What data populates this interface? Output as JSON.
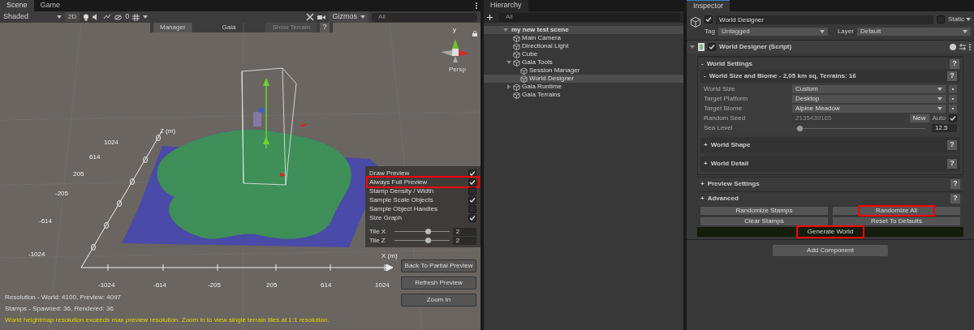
{
  "scene_tabs": [
    {
      "label": "Scene",
      "selected": true
    },
    {
      "label": "Game",
      "selected": false
    }
  ],
  "scene_toolbar": {
    "shading": "Shaded",
    "mode_2d": "2D",
    "hidden_count": "0",
    "gizmos": "Gizmos",
    "search_placeholder": "All"
  },
  "gaia_bar": {
    "manager": "Manager",
    "title": "Gaia",
    "show_terrain": "Show Terrain",
    "help": "?"
  },
  "orientation": {
    "axis": "y",
    "projection": "Persp"
  },
  "plot": {
    "z_label": "Z (m)",
    "x_label": "X (m)",
    "z_ticks": [
      "1024",
      "614",
      "205",
      "-205",
      "-614",
      "-1024"
    ],
    "x_ticks": [
      "-1024",
      "-614",
      "-205",
      "205",
      "614",
      "1024"
    ]
  },
  "preview_options": [
    {
      "label": "Draw Preview",
      "checked": true,
      "highlighted": false
    },
    {
      "label": "Always Full Preview",
      "checked": true,
      "highlighted": true
    },
    {
      "label": "Stamp Density / Width",
      "checked": false,
      "highlighted": false
    },
    {
      "label": "Sample Scale Objects",
      "checked": true,
      "highlighted": false
    },
    {
      "label": "Sample Object Handles",
      "checked": false,
      "highlighted": false
    },
    {
      "label": "Size Graph",
      "checked": true,
      "highlighted": false
    }
  ],
  "tiles": [
    {
      "label": "Tile X",
      "level": 0.6,
      "value": "2"
    },
    {
      "label": "Tile Z",
      "level": 0.6,
      "value": "2"
    }
  ],
  "preview_buttons": [
    "Back To Partial Preview",
    "Refresh Preview",
    "Zoom In"
  ],
  "status_lines": [
    {
      "kind": "info",
      "text": "Resolution - World: 4100, Preview: 4097"
    },
    {
      "kind": "info",
      "text": "Stamps - Spawned: 36, Rendered: 36"
    },
    {
      "kind": "warning",
      "text": "World heightmap resolution exceeds max preview resolution. Zoom in to view single terrain tiles at 1:1 resolution."
    }
  ],
  "hierarchy": {
    "title": "Hierarchy",
    "search_placeholder": "All",
    "scene": "my new test scene",
    "items": [
      {
        "label": "Main Camera",
        "selected": false
      },
      {
        "label": "Directional Light",
        "selected": false
      },
      {
        "label": "Cube",
        "selected": false
      },
      {
        "label": "Gaia Tools",
        "selected": false,
        "expanded": true,
        "children": [
          {
            "label": "Session Manager",
            "selected": false
          },
          {
            "label": "World Designer",
            "selected": true
          }
        ]
      },
      {
        "label": "Gaia Runtime",
        "selected": false,
        "expanded": false
      },
      {
        "label": "Gaia Terrains",
        "selected": false
      }
    ]
  },
  "inspector": {
    "title": "Inspector",
    "object_name": "World Designer",
    "active": true,
    "static_label": "Static",
    "static": false,
    "tag_label": "Tag",
    "tag": "Untagged",
    "layer_label": "Layer",
    "layer": "Default",
    "component": {
      "name": "World Designer (Script)",
      "enabled": true
    },
    "world_settings": {
      "toggle": "-",
      "title": "World Settings",
      "help": "?"
    },
    "biome": {
      "toggle": "-",
      "title": "World Size and Biome - 2,05 km sq, Terrains: 16",
      "help": "?",
      "fields": [
        {
          "kind": "dropdown",
          "label": "World Size",
          "value": "Custom"
        },
        {
          "kind": "dropdown",
          "label": "Target Platform",
          "value": "Desktop"
        },
        {
          "kind": "dropdown",
          "label": "Target Biome",
          "value": "Alpine Meadow"
        },
        {
          "kind": "seed",
          "label": "Random Seed",
          "value": "2135439165",
          "disabled": true,
          "button": "New",
          "auto_label": "Auto",
          "auto": true
        },
        {
          "kind": "slider",
          "label": "Sea Level",
          "level": 0.03,
          "value": "12.5"
        }
      ]
    },
    "subsections": [
      {
        "toggle": "+",
        "title": "World Shape",
        "help": "?"
      },
      {
        "toggle": "+",
        "title": "World Detail",
        "help": "?"
      }
    ],
    "sections": [
      {
        "toggle": "+",
        "title": "Preview Settings",
        "help": "?"
      },
      {
        "toggle": "+",
        "title": "Advanced",
        "help": "?"
      }
    ],
    "actions": [
      {
        "label": "Randomize Stamps",
        "highlighted": false
      },
      {
        "label": "Randomize All",
        "highlighted": true
      },
      {
        "label": "Clear Stamps",
        "highlighted": false
      },
      {
        "label": "Reset To Defaults",
        "highlighted": false
      }
    ],
    "generate": {
      "label": "Generate World",
      "highlighted": true
    },
    "add_component": "Add Component"
  }
}
